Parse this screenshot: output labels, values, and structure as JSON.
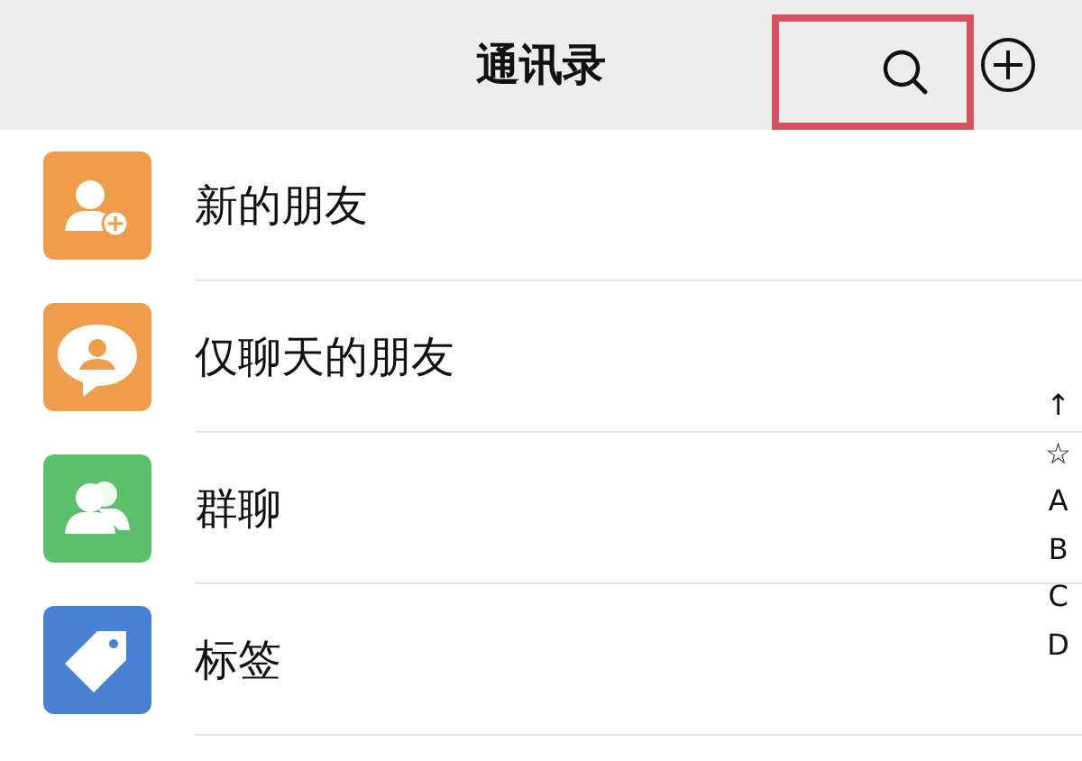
{
  "header": {
    "title": "通讯录",
    "search": {
      "highlighted": true
    }
  },
  "items": [
    {
      "kind": "add-friend",
      "label": "新的朋友",
      "color": "#ef9d4a"
    },
    {
      "kind": "chat-friend",
      "label": "仅聊天的朋友",
      "color": "#ef9d4a"
    },
    {
      "kind": "group",
      "label": "群聊",
      "color": "#5cbf6a"
    },
    {
      "kind": "tag",
      "label": "标签",
      "color": "#4a81d4"
    }
  ],
  "index": [
    "↑",
    "☆",
    "A",
    "B",
    "C",
    "D"
  ]
}
